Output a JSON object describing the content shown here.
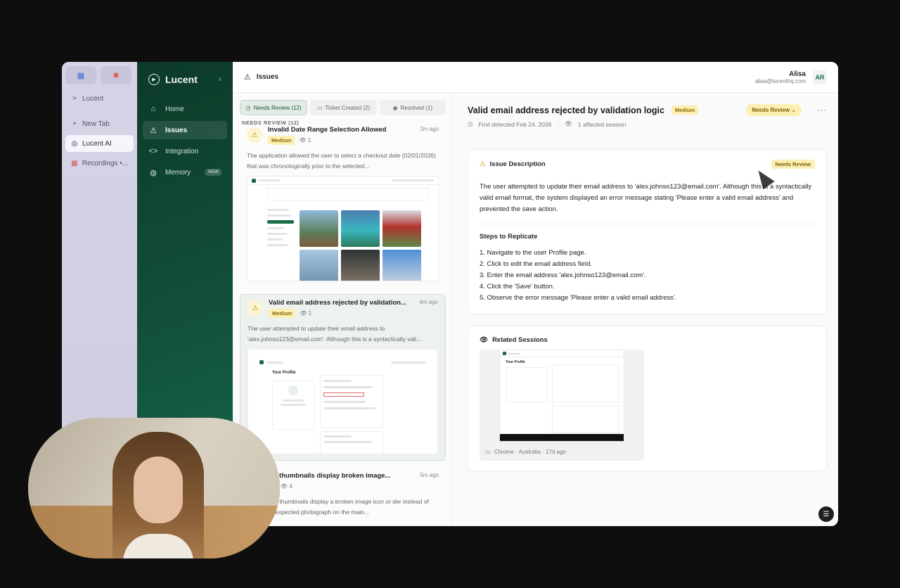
{
  "browser": {
    "tabs": [
      {
        "label": "Lucent",
        "icon": ">"
      },
      {
        "label": "New Tab",
        "icon": "+"
      },
      {
        "label": "Lucent AI",
        "icon": "◎"
      },
      {
        "label": "Recordings •...",
        "icon": "▦"
      }
    ]
  },
  "sidebar": {
    "brand": "Lucent",
    "items": [
      {
        "label": "Home",
        "icon": "home-icon"
      },
      {
        "label": "Issues",
        "icon": "warning-icon"
      },
      {
        "label": "Integration",
        "icon": "code-icon"
      },
      {
        "label": "Memory",
        "icon": "globe-icon",
        "badge": "NEW"
      }
    ]
  },
  "topbar": {
    "title": "Issues",
    "user_name": "Alisa",
    "user_email": "alisa@lucenthq.com",
    "avatar_initials": "AR"
  },
  "list": {
    "filters": [
      "Needs Review (12)",
      "Ticket Created (2)",
      "Resolved (1)"
    ],
    "section_label": "NEEDS REVIEW (12)",
    "cards": [
      {
        "title": "Invalid Date Range Selection Allowed",
        "severity": "Medium",
        "views": "1",
        "time": "2m ago",
        "desc": "The application allowed the user to select a checkout date (02/01/2026) that was chronologically prior to the selected..."
      },
      {
        "title": "Valid email address rejected by validation...",
        "severity": "Medium",
        "views": "1",
        "time": "4m ago",
        "desc": "The user attempted to update their email address to 'alex.johnso123@email.com'. Although this is a syntactically vali..."
      },
      {
        "title": "ting thumbnails display broken image...",
        "severity": "w",
        "views": "4",
        "time": "5m ago",
        "desc": "sting thumbnails display a broken image icon or der instead of the expected photograph on the main..."
      }
    ]
  },
  "detail": {
    "title": "Valid email address rejected by validation logic",
    "severity": "Medium",
    "status": "Needs Review",
    "first_detected": "First detected Feb 24, 2026",
    "affected": "1 affected session",
    "description_heading": "Issue Description",
    "description_tag": "Needs Review",
    "description": "The user attempted to update their email address to 'alex.johnso123@email.com'. Although this is a syntactically valid email format, the system displayed an error message stating 'Please enter a valid email address' and prevented the save action.",
    "steps_heading": "Steps to Replicate",
    "steps": [
      "1. Navigate to the user Profile page.",
      "2. Click to edit the email address field.",
      "3. Enter the email address 'alex.johnso123@email.com'.",
      "4. Click the 'Save' button.",
      "5. Observe the error message 'Please enter a valid email address'."
    ],
    "sessions_heading": "Related Sessions",
    "session_meta": "Chrome · Australia · 17d ago"
  },
  "colors": {
    "sidebar_green": "#12503a",
    "accent_green": "#1e6b4a",
    "badge_yellow": "#fcefb4"
  }
}
